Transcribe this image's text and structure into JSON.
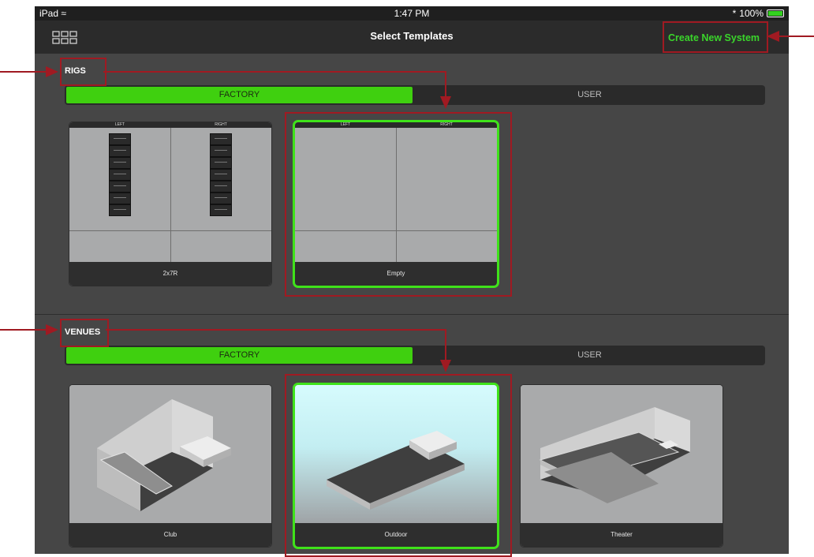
{
  "statusbar": {
    "device": "iPad",
    "time": "1:47 PM",
    "battery": "100%"
  },
  "navbar": {
    "title": "Select Templates",
    "create_label": "Create New System"
  },
  "rigs": {
    "label": "RIGS",
    "tabs": {
      "factory": "FACTORY",
      "user": "USER"
    },
    "cards": [
      {
        "name": "2x7R",
        "left_label": "LEFT",
        "right_label": "RIGHT",
        "speakers_per_side": 7,
        "selected": false
      },
      {
        "name": "Empty",
        "left_label": "LEFT",
        "right_label": "RIGHT",
        "speakers_per_side": 0,
        "selected": true
      }
    ]
  },
  "venues": {
    "label": "VENUES",
    "tabs": {
      "factory": "FACTORY",
      "user": "USER"
    },
    "cards": [
      {
        "name": "Club",
        "selected": false
      },
      {
        "name": "Outdoor",
        "selected": true
      },
      {
        "name": "Theater",
        "selected": false
      }
    ]
  },
  "colors": {
    "accent": "#3fd00f",
    "selection": "#3fe21a",
    "annotation": "#a01a22",
    "panel": "#464646"
  }
}
